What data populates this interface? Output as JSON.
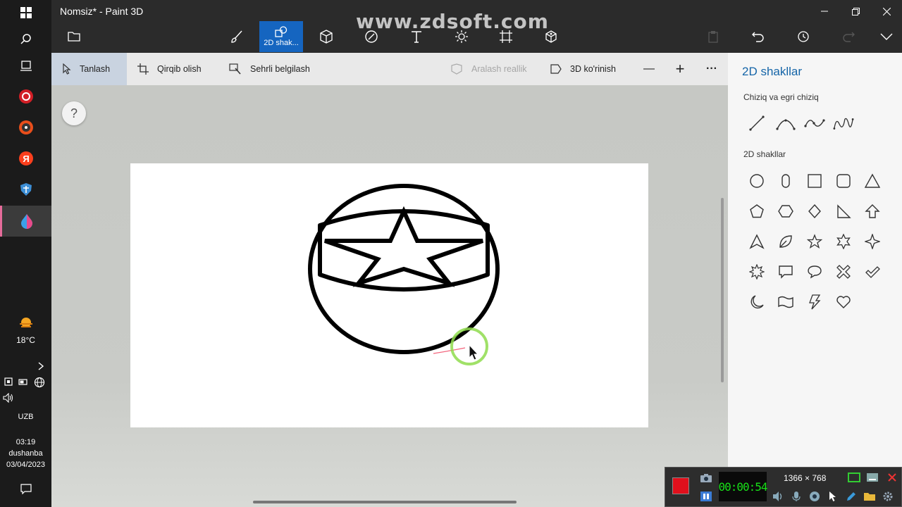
{
  "taskbar": {
    "weather_temp": "18°C",
    "language": "UZB",
    "time": "03:19",
    "day": "dushanba",
    "date": "03/04/2023",
    "icons": [
      "windows-icon",
      "search-icon",
      "task-view-icon",
      "opera-icon",
      "media-icon",
      "yandex-icon",
      "shield-app-icon",
      "paint3d-icon"
    ]
  },
  "titlebar": {
    "title": "Nomsiz* - Paint 3D",
    "watermark": "www.zdsoft.com",
    "active_tool_label": "2D shak..."
  },
  "commandbar": {
    "select": "Tanlash",
    "crop": "Qirqib olish",
    "magic_select": "Sehrli belgilash",
    "mixed_reality": "Aralash reallik",
    "view_3d": "3D ko'rinish",
    "zoom_out": "—",
    "zoom_in": "+",
    "more": "···"
  },
  "workspace": {
    "help": "?"
  },
  "panel": {
    "title": "2D shakllar",
    "lines_section": "Chiziq va egri chiziq",
    "shapes_section": "2D shakllar"
  },
  "recorder": {
    "timer": "00:00:54",
    "resolution": "1366 × 768"
  },
  "colors": {
    "accent": "#1565c0",
    "panel_title": "#1565a8",
    "record": "#e0101c",
    "timer": "#18e018"
  }
}
